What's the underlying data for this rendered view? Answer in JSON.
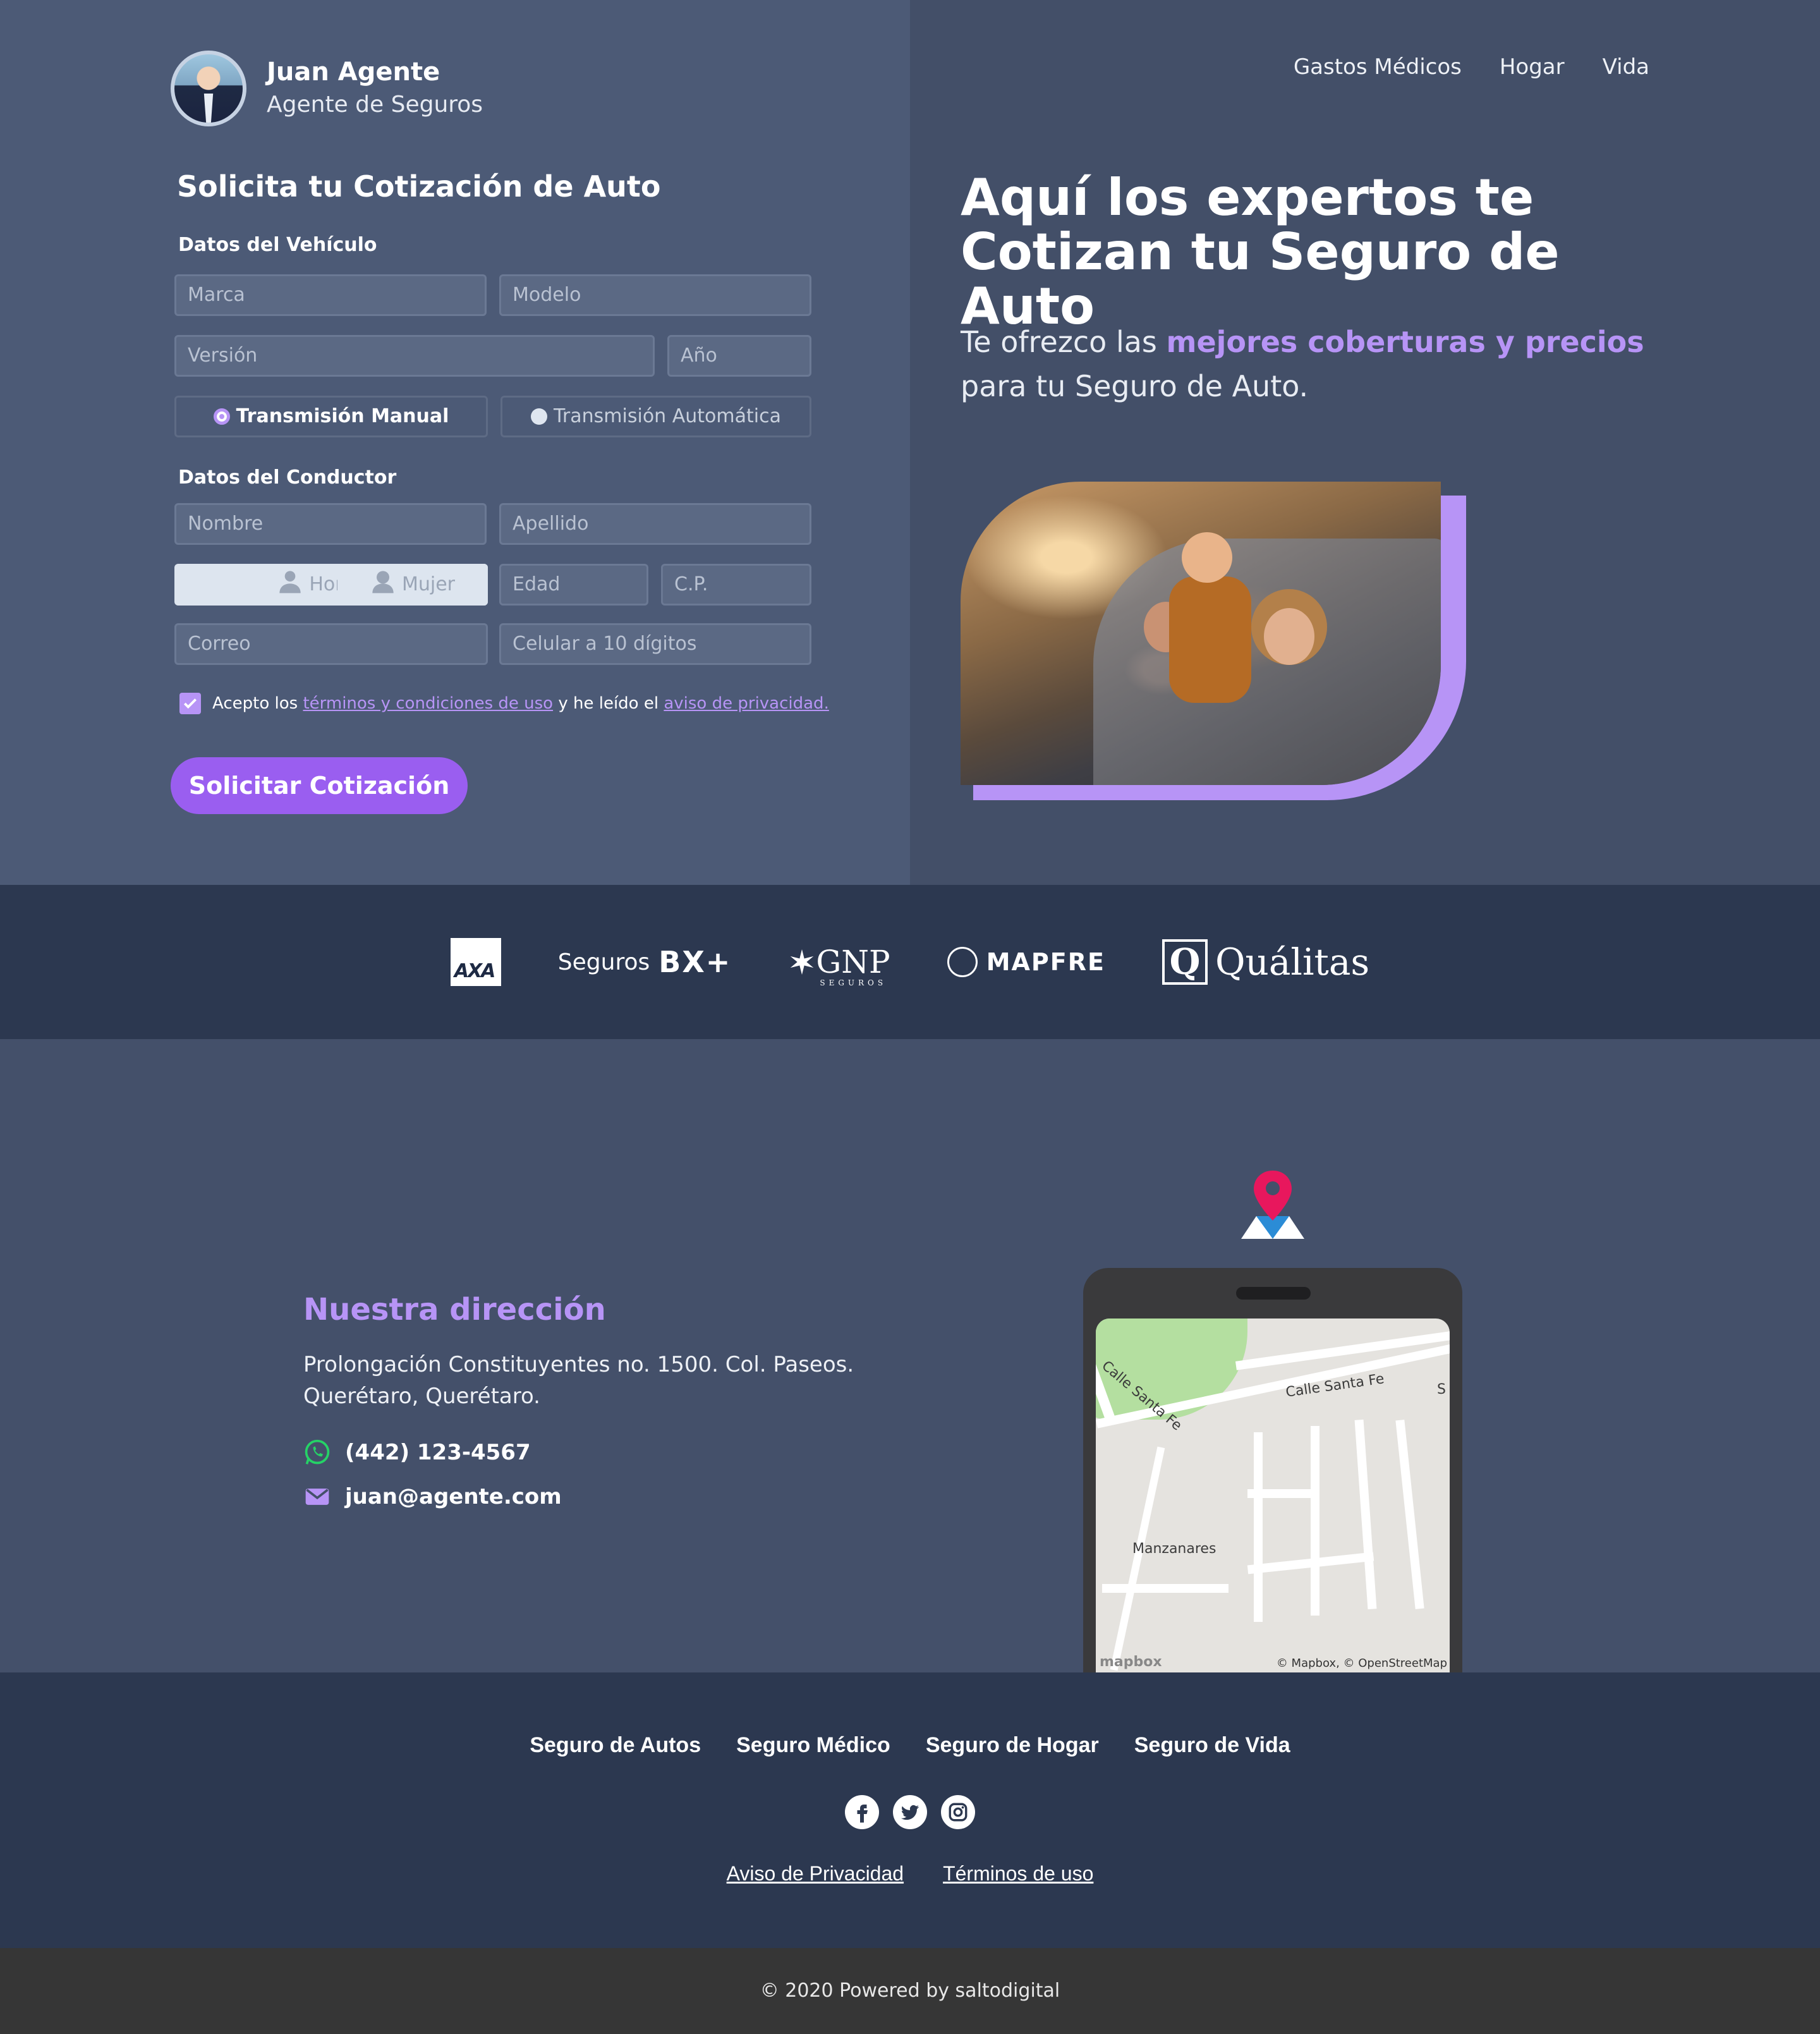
{
  "agent": {
    "name": "Juan Agente",
    "role": "Agente de Seguros"
  },
  "nav": {
    "items": [
      "Gastos Médicos",
      "Hogar",
      "Vida"
    ]
  },
  "form": {
    "title": "Solicita tu Cotización de Auto",
    "vehicle_label": "Datos del Vehículo",
    "driver_label": "Datos del Conductor",
    "placeholders": {
      "marca": "Marca",
      "modelo": "Modelo",
      "version": "Versión",
      "anio": "Año",
      "nombre": "Nombre",
      "apellido": "Apellido",
      "edad": "Edad",
      "cp": "C.P.",
      "correo": "Correo",
      "celular": "Celular a 10 dígitos"
    },
    "transmission": {
      "manual": "Transmisión Manual",
      "automatic": "Transmisión Automática",
      "selected": "manual"
    },
    "gender": {
      "male": "Hombre",
      "female": "Mujer"
    },
    "terms": {
      "prefix": "Acepto los",
      "link1": "términos y condiciones de uso",
      "middle": "y he leído el",
      "link2": "aviso de privacidad."
    },
    "submit": "Solicitar Cotización"
  },
  "hero": {
    "title_line1": "Aquí los expertos te",
    "title_line2": "Cotizan tu Seguro de Auto",
    "sub_prefix": "Te ofrezco las",
    "sub_highlight": "mejores coberturas y precios",
    "sub_suffix": "para tu Seguro de Auto."
  },
  "insurers": {
    "axa": "AXA",
    "bx_prefix": "Seguros",
    "bx": "BX+",
    "gnp": "GNP",
    "gnp_sub": "SEGUROS",
    "mapfre": "MAPFRE",
    "qualitas_mark": "Q",
    "qualitas": "Quálitas"
  },
  "address": {
    "title": "Nuestra dirección",
    "line1": "Prolongación Constituyentes no. 1500. Col. Paseos.",
    "line2": "Querétaro, Querétaro.",
    "phone": "(442) 123-4567",
    "email": "juan@agente.com"
  },
  "map": {
    "label_street1": "Calle Santa Fe",
    "label_street2": "Calle Santa Fe",
    "label_area": "Manzanares",
    "label_edge": "S",
    "brand": "mapbox",
    "credit": "© Mapbox, © OpenStreetMap"
  },
  "footer": {
    "links": [
      "Seguro de Autos",
      "Seguro Médico",
      "Seguro de Hogar",
      "Seguro de Vida"
    ],
    "social_icons": [
      "facebook-icon",
      "twitter-icon",
      "instagram-icon"
    ],
    "legal": [
      "Aviso de Privacidad",
      "Términos de uso"
    ]
  },
  "copyright": "© 2020 Powered by saltodigital",
  "colors": {
    "accent": "#b794f6",
    "button": "#9a5ef0",
    "bg_left": "#4c5a76",
    "bg_right": "#434f68",
    "band": "#2c3850",
    "whatsapp": "#25d366"
  }
}
